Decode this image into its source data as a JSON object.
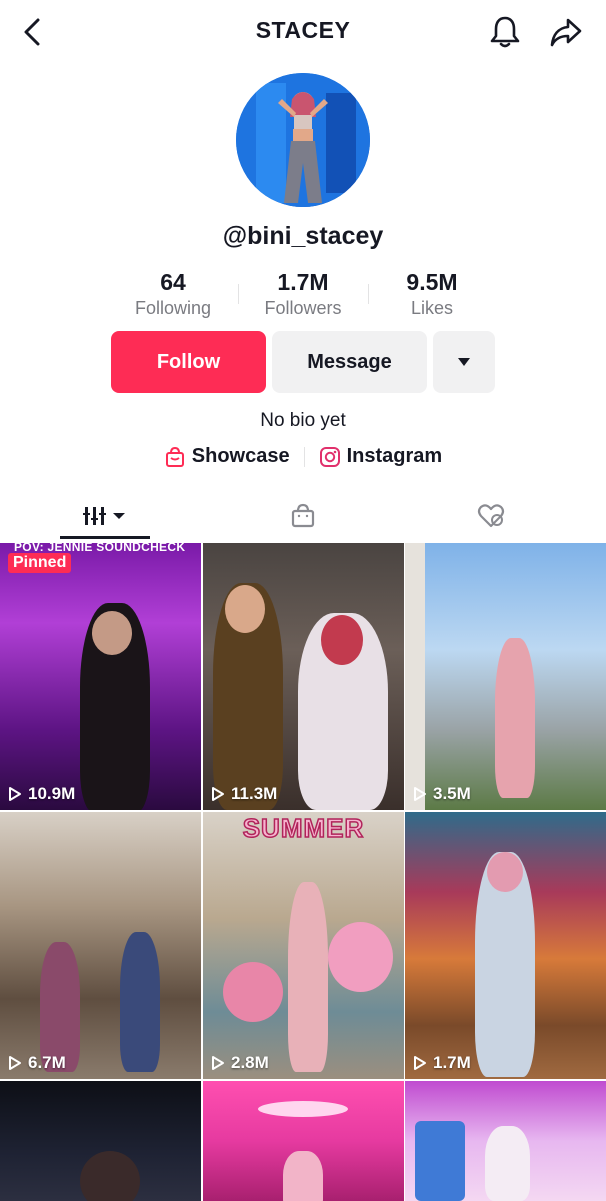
{
  "header": {
    "title": "STACEY",
    "back_icon": "chevron-left-icon",
    "bell_icon": "bell-icon",
    "share_icon": "share-arrow-icon"
  },
  "profile": {
    "username": "@bini_stacey",
    "stats": [
      {
        "value": "64",
        "label": "Following"
      },
      {
        "value": "1.7M",
        "label": "Followers"
      },
      {
        "value": "9.5M",
        "label": "Likes"
      }
    ],
    "follow_label": "Follow",
    "message_label": "Message",
    "bio": "No bio yet",
    "links": [
      {
        "label": "Showcase",
        "icon": "shop-bag-icon"
      },
      {
        "label": "Instagram",
        "icon": "instagram-icon"
      }
    ]
  },
  "tabs": [
    {
      "name": "videos",
      "icon": "grid-bars-icon"
    },
    {
      "name": "shop",
      "icon": "shop-bag-icon"
    },
    {
      "name": "liked",
      "icon": "hidden-heart-icon"
    }
  ],
  "videos": [
    {
      "views": "10.9M",
      "pinned_label": "Pinned",
      "caption": "POV: JENNIE SOUNDCHECK"
    },
    {
      "views": "11.3M"
    },
    {
      "views": "3.5M"
    },
    {
      "views": "6.7M"
    },
    {
      "views": "2.8M",
      "overlay_text": "SUMMER"
    },
    {
      "views": "1.7M"
    },
    {
      "views": ""
    },
    {
      "views": ""
    },
    {
      "views": ""
    }
  ],
  "colors": {
    "accent": "#fe2c55",
    "secondary_button": "#f1f1f2",
    "text": "#161823",
    "muted": "#7a7b81"
  }
}
